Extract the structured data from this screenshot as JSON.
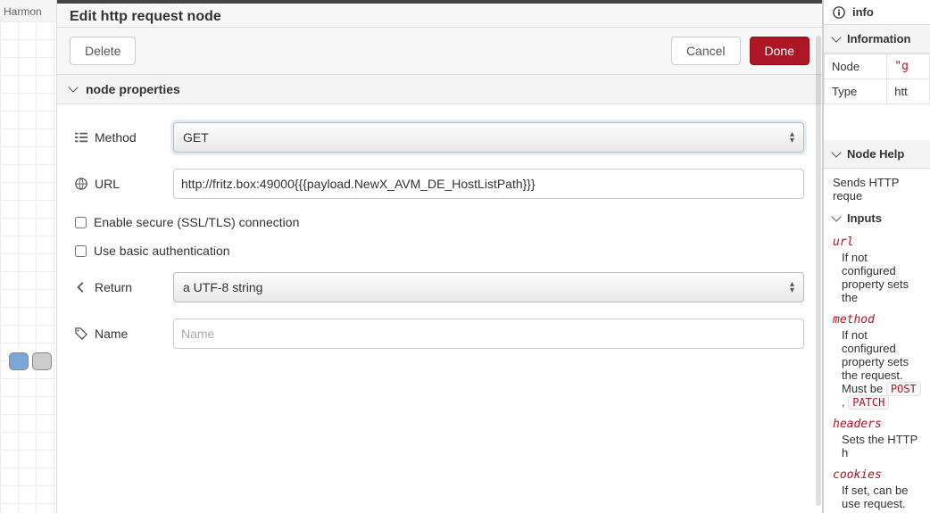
{
  "palette": {
    "category": "Harmon"
  },
  "editor": {
    "title": "Edit http request node",
    "buttons": {
      "delete": "Delete",
      "cancel": "Cancel",
      "done": "Done"
    },
    "section": "node properties",
    "fields": {
      "method_label": "Method",
      "method_value": "GET",
      "url_label": "URL",
      "url_value": "http://fritz.box:49000{{{payload.NewX_AVM_DE_HostListPath}}}",
      "ssl_label": "Enable secure (SSL/TLS) connection",
      "auth_label": "Use basic authentication",
      "return_label": "Return",
      "return_value": "a UTF-8 string",
      "name_label": "Name",
      "name_placeholder": "Name"
    }
  },
  "sidebar": {
    "tab": "info",
    "information_title": "Information",
    "rows": {
      "node_k": "Node",
      "node_v": "\"g",
      "type_k": "Type",
      "type_v": "htt"
    },
    "help_title": "Node Help",
    "help_intro": "Sends HTTP reque",
    "inputs_title": "Inputs",
    "inputs": {
      "url_k": "url",
      "url_d": "If not configured property sets the",
      "method_k": "method",
      "method_d": "If not configured property sets the request. Must be",
      "method_codes": [
        "POST",
        "PATCH"
      ],
      "headers_k": "headers",
      "headers_d": "Sets the HTTP h",
      "cookies_k": "cookies",
      "cookies_d": "If set, can be use request."
    }
  }
}
